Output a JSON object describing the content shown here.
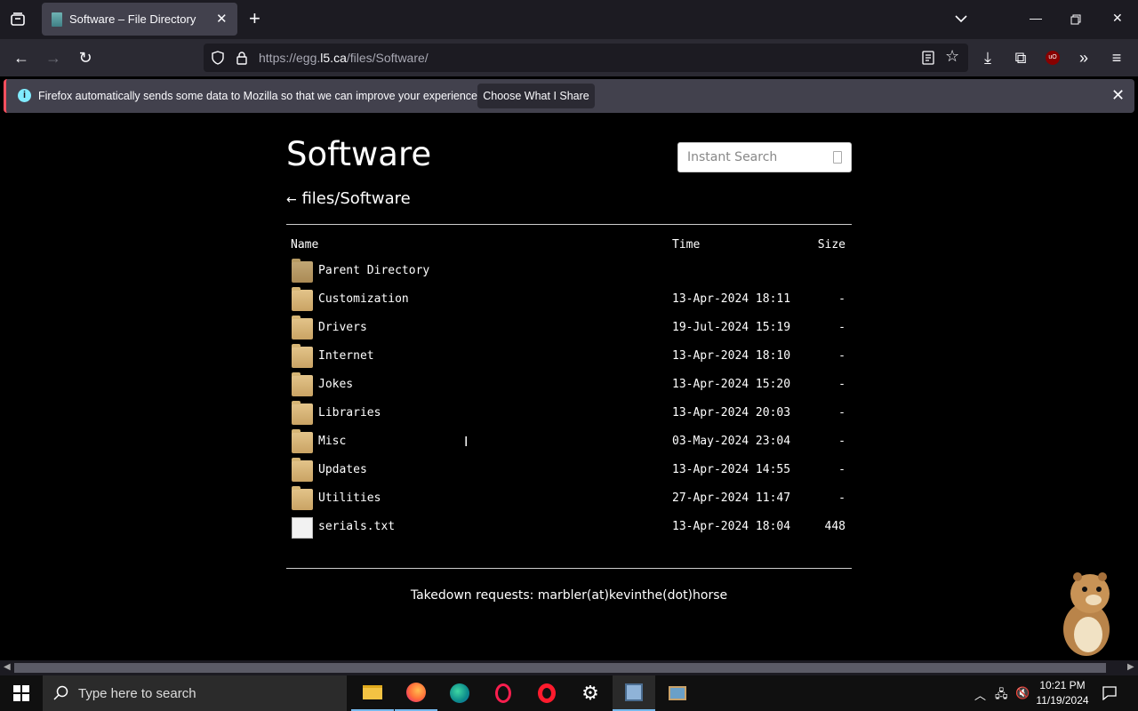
{
  "browser": {
    "tab": {
      "title": "Software – File Directory"
    },
    "url_prefix": "https://egg.",
    "url_host": "l5.ca",
    "url_path": "/files/Software/"
  },
  "notification": {
    "message": "Firefox automatically sends some data to Mozilla so that we can improve your experience.",
    "button_label": "Choose What I Share"
  },
  "page": {
    "title": "Software",
    "search_placeholder": "Instant Search",
    "breadcrumb_arrow": "←",
    "breadcrumb": "files/Software",
    "columns": {
      "name": "Name",
      "time": "Time",
      "size": "Size"
    },
    "rows": [
      {
        "name": "Parent Directory",
        "time": "",
        "size": "",
        "type": "parent"
      },
      {
        "name": "Customization",
        "time": "13-Apr-2024 18:11",
        "size": "-",
        "type": "folder"
      },
      {
        "name": "Drivers",
        "time": "19-Jul-2024 15:19",
        "size": "-",
        "type": "folder"
      },
      {
        "name": "Internet",
        "time": "13-Apr-2024 18:10",
        "size": "-",
        "type": "folder"
      },
      {
        "name": "Jokes",
        "time": "13-Apr-2024 15:20",
        "size": "-",
        "type": "folder"
      },
      {
        "name": "Libraries",
        "time": "13-Apr-2024 20:03",
        "size": "-",
        "type": "folder"
      },
      {
        "name": "Misc",
        "time": "03-May-2024 23:04",
        "size": "-",
        "type": "folder"
      },
      {
        "name": "Updates",
        "time": "13-Apr-2024 14:55",
        "size": "-",
        "type": "folder"
      },
      {
        "name": "Utilities",
        "time": "27-Apr-2024 11:47",
        "size": "-",
        "type": "folder"
      },
      {
        "name": "serials.txt",
        "time": "13-Apr-2024 18:04",
        "size": "448",
        "type": "file"
      }
    ],
    "footer": "Takedown requests: marbler(at)kevinthe(dot)horse"
  },
  "taskbar": {
    "search_placeholder": "Type here to search",
    "time": "10:21 PM",
    "date": "11/19/2024"
  }
}
